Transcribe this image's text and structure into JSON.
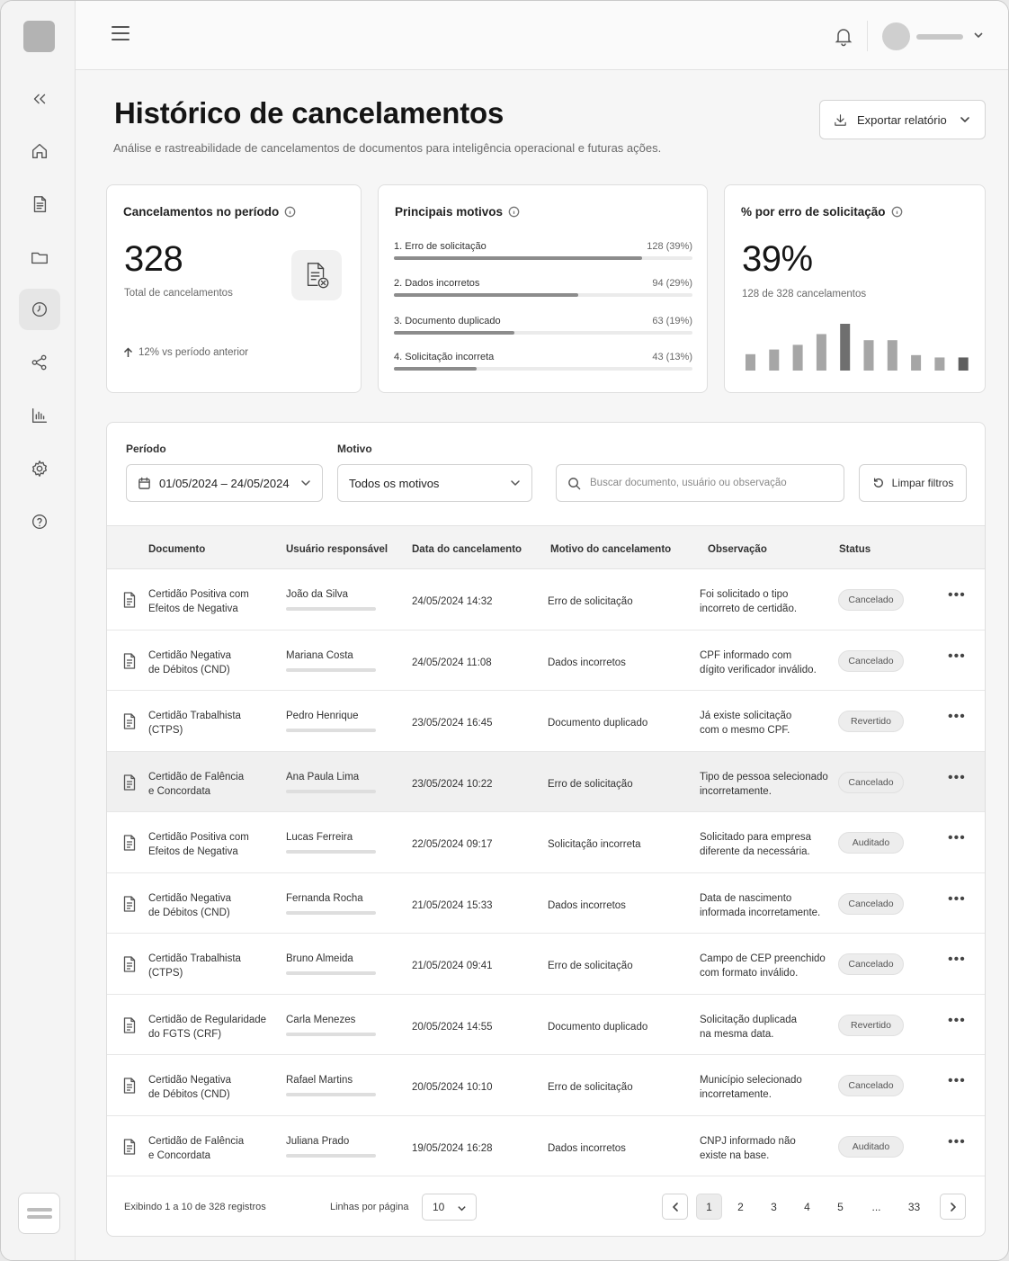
{
  "topbar": {
    "user_name_placeholder": ""
  },
  "header": {
    "title": "Histórico de cancelamentos",
    "subtitle": "Análise e rastreabilidade de cancelamentos de documentos para inteligência operacional e futuras ações.",
    "export_label": "Exportar relatório"
  },
  "cards": {
    "total": {
      "title": "Cancelamentos no período",
      "value": "328",
      "caption": "Total de cancelamentos",
      "trend": "12% vs período anterior"
    },
    "reasons": {
      "title": "Principais motivos",
      "items": [
        {
          "label": "1. Erro de solicitação",
          "value": "128 (39%)",
          "pct": 0.39
        },
        {
          "label": "2. Dados incorretos",
          "value": "94 (29%)",
          "pct": 0.29
        },
        {
          "label": "3. Documento duplicado",
          "value": "63 (19%)",
          "pct": 0.19
        },
        {
          "label": "4. Solicitação incorreta",
          "value": "43 (13%)",
          "pct": 0.13
        }
      ]
    },
    "error_pct": {
      "title": "% por erro de solicitação",
      "value": "39%",
      "caption": "128 de 328 cancelamentos",
      "bars": [
        0.35,
        0.45,
        0.55,
        0.78,
        1.0,
        0.65,
        0.65,
        0.33,
        0.28,
        0.28
      ]
    }
  },
  "filters": {
    "period_label": "Período",
    "period_value": "01/05/2024 – 24/05/2024",
    "reason_label": "Motivo",
    "reason_value": "Todos os motivos",
    "search_placeholder": "Buscar documento, usuário ou observação",
    "clear_label": "Limpar filtros"
  },
  "table": {
    "columns": [
      "Documento",
      "Usuário responsável",
      "Data do cancelamento",
      "Motivo do cancelamento",
      "Observação",
      "Status"
    ],
    "rows": [
      {
        "doc": [
          "Certidão Positiva com",
          "Efeitos de Negativa"
        ],
        "user": "João da Silva",
        "date": "24/05/2024 14:32",
        "reason": "Erro de solicitação",
        "obs": [
          "Foi solicitado o tipo",
          "incorreto de certidão."
        ],
        "status": "Cancelado"
      },
      {
        "doc": [
          "Certidão Negativa",
          "de Débitos (CND)"
        ],
        "user": "Mariana Costa",
        "date": "24/05/2024 11:08",
        "reason": "Dados incorretos",
        "obs": [
          "CPF informado com",
          "dígito verificador inválido."
        ],
        "status": "Cancelado"
      },
      {
        "doc": [
          "Certidão Trabalhista",
          "(CTPS)"
        ],
        "user": "Pedro Henrique",
        "date": "23/05/2024 16:45",
        "reason": "Documento duplicado",
        "obs": [
          "Já existe solicitação",
          "com o mesmo CPF."
        ],
        "status": "Revertido"
      },
      {
        "doc": [
          "Certidão de Falência",
          "e Concordata"
        ],
        "user": "Ana Paula Lima",
        "date": "23/05/2024 10:22",
        "reason": "Erro de solicitação",
        "obs": [
          "Tipo de pessoa selecionado",
          "incorretamente."
        ],
        "status": "Cancelado"
      },
      {
        "doc": [
          "Certidão Positiva com",
          "Efeitos de Negativa"
        ],
        "user": "Lucas Ferreira",
        "date": "22/05/2024 09:17",
        "reason": "Solicitação incorreta",
        "obs": [
          "Solicitado para empresa",
          "diferente da necessária."
        ],
        "status": "Auditado"
      },
      {
        "doc": [
          "Certidão Negativa",
          "de Débitos (CND)"
        ],
        "user": "Fernanda Rocha",
        "date": "21/05/2024 15:33",
        "reason": "Dados incorretos",
        "obs": [
          "Data de nascimento",
          "informada incorretamente."
        ],
        "status": "Cancelado"
      },
      {
        "doc": [
          "Certidão Trabalhista",
          "(CTPS)"
        ],
        "user": "Bruno Almeida",
        "date": "21/05/2024 09:41",
        "reason": "Erro de solicitação",
        "obs": [
          "Campo de CEP preenchido",
          "com formato inválido."
        ],
        "status": "Cancelado"
      },
      {
        "doc": [
          "Certidão de Regularidade",
          "do FGTS (CRF)"
        ],
        "user": "Carla Menezes",
        "date": "20/05/2024 14:55",
        "reason": "Documento duplicado",
        "obs": [
          "Solicitação duplicada",
          "na mesma data."
        ],
        "status": "Revertido"
      },
      {
        "doc": [
          "Certidão Negativa",
          "de Débitos (CND)"
        ],
        "user": "Rafael Martins",
        "date": "20/05/2024 10:10",
        "reason": "Erro de solicitação",
        "obs": [
          "Município selecionado",
          "incorretamente."
        ],
        "status": "Cancelado"
      },
      {
        "doc": [
          "Certidão de Falência",
          "e Concordata"
        ],
        "user": "Juliana Prado",
        "date": "19/05/2024 16:28",
        "reason": "Dados incorretos",
        "obs": [
          "CNPJ informado não",
          "existe na base."
        ],
        "status": "Auditado"
      }
    ]
  },
  "pagination": {
    "summary": "Exibindo 1 a 10 de 328 registros",
    "rows_label": "Linhas por página",
    "rows_value": "10",
    "pages": [
      "1",
      "2",
      "3",
      "4",
      "5",
      "...",
      "33"
    ],
    "current": "1"
  }
}
